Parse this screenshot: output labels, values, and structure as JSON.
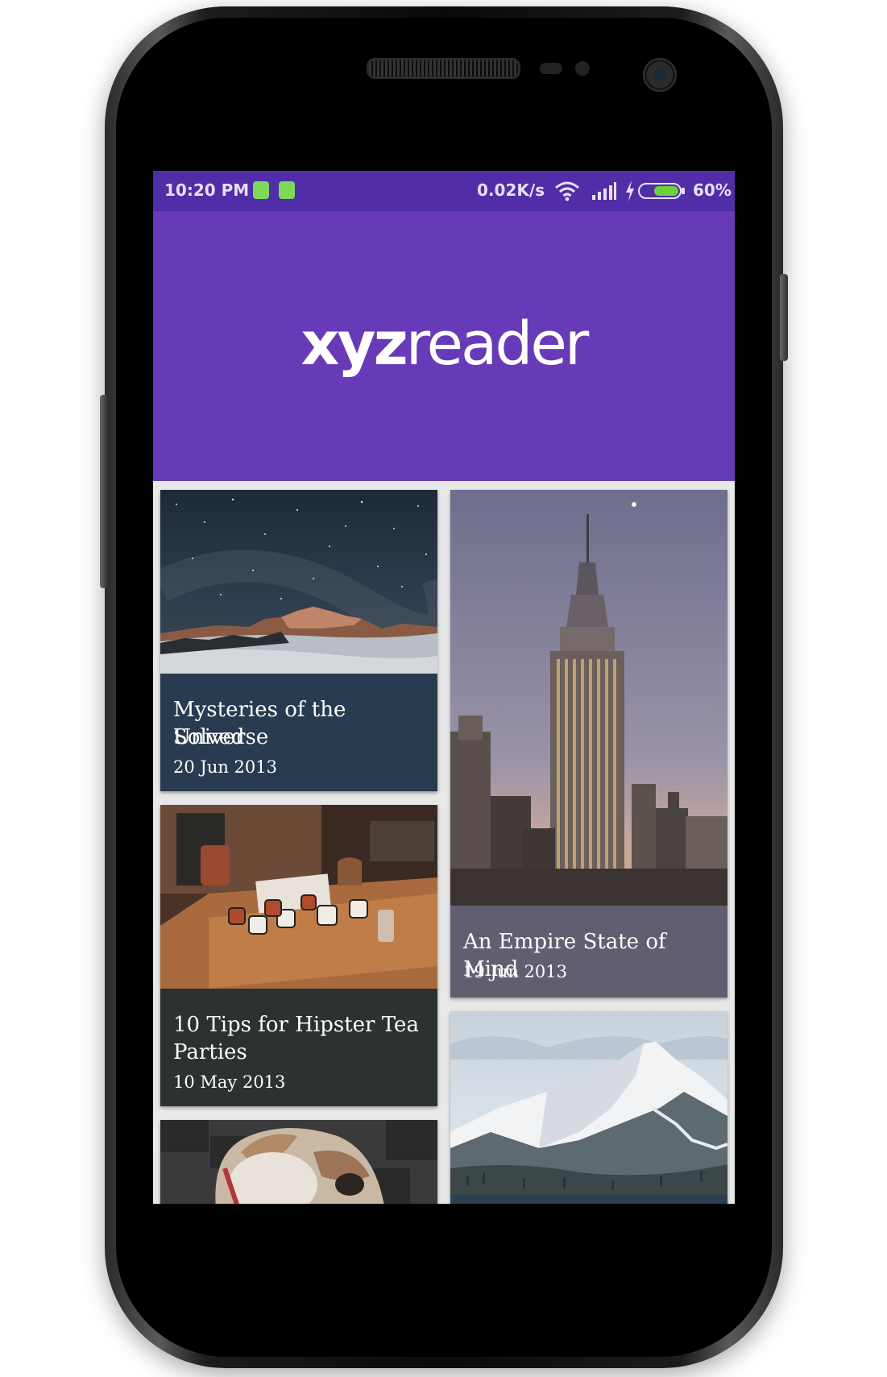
{
  "status_bar": {
    "time": "10:20 PM",
    "net_speed": "0.02K/s",
    "battery_percent": "60%",
    "icons": [
      "battery-saver-icon",
      "android-icon",
      "wifi-icon",
      "signal-icon",
      "charging-icon",
      "battery-icon"
    ]
  },
  "app": {
    "logo_bold": "xyz",
    "logo_light": "reader",
    "toolbar_color": "#673ab7",
    "statusbar_color": "#512da8"
  },
  "articles": [
    {
      "title_line1": "Mysteries of the Universe",
      "title_line2": "Solved",
      "date": "20 Jun 2013",
      "meta_color": "#283b50",
      "image": "starry-sky-mountain"
    },
    {
      "title_line1": "An Empire State of Mind",
      "title_line2": "",
      "date": "19 Jun 2013",
      "meta_color": "#625e70",
      "image": "empire-state-building"
    },
    {
      "title_line1": "10 Tips for Hipster Tea",
      "title_line2": "Parties",
      "date": "10 May 2013",
      "meta_color": "#2c3132",
      "image": "tea-cups-table"
    },
    {
      "title_line1": "",
      "title_line2": "",
      "date": "",
      "meta_color": "#2d3f52",
      "image": "snowy-mountain"
    },
    {
      "title_line1": "",
      "title_line2": "",
      "date": "",
      "meta_color": "#3a3a3a",
      "image": "bulldog"
    }
  ]
}
